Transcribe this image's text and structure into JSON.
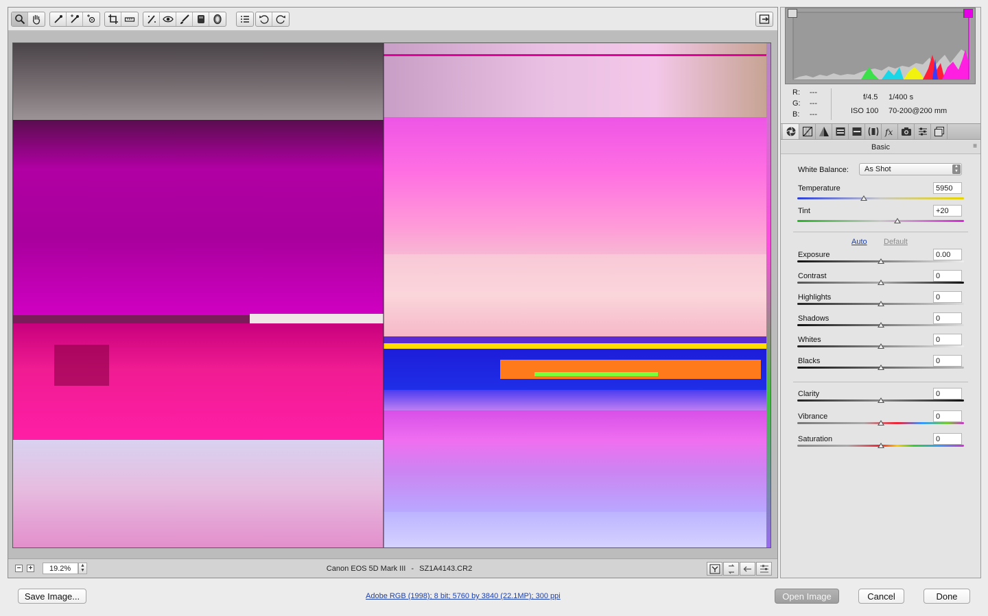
{
  "toolbar": {
    "tools": [
      "zoom-tool",
      "hand-tool",
      "white-balance-tool",
      "color-sampler-tool",
      "targeted-adjustment-tool",
      "crop-tool",
      "straighten-tool",
      "spot-removal-tool",
      "red-eye-removal-tool",
      "adjustment-brush",
      "graduated-filter",
      "radial-filter",
      "preferences",
      "rotate-left",
      "rotate-right"
    ],
    "fullscreen": "fullscreen-toggle"
  },
  "status": {
    "zoom": "19.2%",
    "camera": "Canon EOS 5D Mark III",
    "separator": "-",
    "file": "SZ1A4143.CR2"
  },
  "readout": {
    "r_label": "R:",
    "r_value": "---",
    "g_label": "G:",
    "g_value": "---",
    "b_label": "B:",
    "b_value": "---",
    "aperture": "f/4.5",
    "shutter": "1/400 s",
    "iso": "ISO 100",
    "lens": "70-200@200 mm"
  },
  "panel": {
    "title": "Basic",
    "menu_icon": "≡",
    "white_balance_label": "White Balance:",
    "white_balance_value": "As Shot",
    "temperature_label": "Temperature",
    "temperature_value": "5950",
    "temperature_level": 0.4,
    "tint_label": "Tint",
    "tint_value": "+20",
    "tint_level": 0.6,
    "auto_label": "Auto",
    "default_label": "Default",
    "sliders": [
      {
        "label": "Exposure",
        "value": "0.00",
        "level": 0.5
      },
      {
        "label": "Contrast",
        "value": "0",
        "level": 0.5
      },
      {
        "label": "Highlights",
        "value": "0",
        "level": 0.5
      },
      {
        "label": "Shadows",
        "value": "0",
        "level": 0.5
      },
      {
        "label": "Whites",
        "value": "0",
        "level": 0.5
      },
      {
        "label": "Blacks",
        "value": "0",
        "level": 0.5
      }
    ],
    "presence": [
      {
        "label": "Clarity",
        "value": "0",
        "level": 0.5
      },
      {
        "label": "Vibrance",
        "value": "0",
        "level": 0.5
      },
      {
        "label": "Saturation",
        "value": "0",
        "level": 0.5
      }
    ]
  },
  "footer": {
    "save": "Save Image...",
    "workflow": "Adobe RGB (1998); 8 bit; 5760 by 3840 (22.1MP); 300 ppi",
    "open": "Open Image",
    "cancel": "Cancel",
    "done": "Done"
  },
  "colors": {
    "accent_magenta": "#e600e6",
    "link_blue": "#1a3fb0"
  }
}
